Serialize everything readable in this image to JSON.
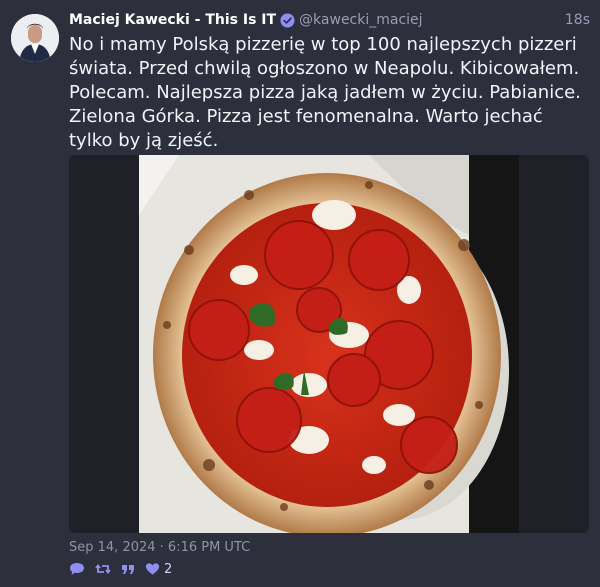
{
  "author": {
    "display_name": "Maciej Kawecki - This Is IT",
    "handle": "@kawecki_maciej",
    "verified": true,
    "avatar_icon": "avatar-photo"
  },
  "tweet": {
    "relative_time": "18s",
    "text": "No i mamy Polską pizzerię w top 100 najlepszych pizzeri świata. Przed chwilą ogłoszono w Neapolu. Kibicowałem. Polecam. Najlepsza pizza jaką jadłem w życiu. Pabianice. Zielona Górka. Pizza jest fenomenalna. Warto jechać tylko by ją zjeść.",
    "date": "Sep 14, 2024 · 6:16 PM UTC",
    "media_icon": "pizza-photo"
  },
  "actions": {
    "reply_icon": "speech-bubble-icon",
    "retweet_icon": "retweet-icon",
    "quote_icon": "quote-icon",
    "like_icon": "heart-icon",
    "like_count": "2"
  },
  "colors": {
    "background": "#2d2f3c",
    "accent": "#8f8ff2",
    "verified": "#8f8ff2"
  }
}
